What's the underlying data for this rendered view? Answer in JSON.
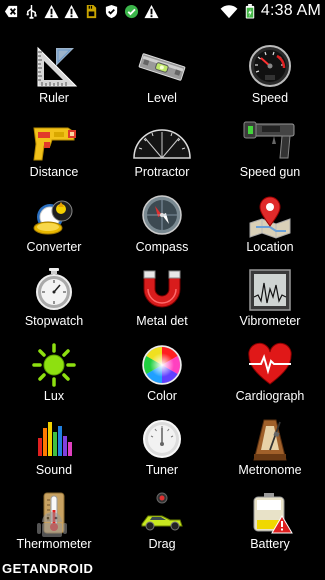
{
  "statusbar": {
    "time": "4:38 AM",
    "icons": [
      "notification-icon",
      "usb-icon",
      "warning-icon",
      "warning-icon",
      "sd-card-icon",
      "shield-icon",
      "check-circle-icon",
      "warning-icon",
      "wifi-icon",
      "battery-charging-icon"
    ]
  },
  "tools": [
    {
      "label": "Ruler",
      "icon": "ruler-icon"
    },
    {
      "label": "Level",
      "icon": "level-icon"
    },
    {
      "label": "Speed",
      "icon": "speedometer-icon"
    },
    {
      "label": "Distance",
      "icon": "laser-gun-icon"
    },
    {
      "label": "Protractor",
      "icon": "protractor-icon"
    },
    {
      "label": "Speed gun",
      "icon": "speed-gun-icon"
    },
    {
      "label": "Converter",
      "icon": "converter-icon"
    },
    {
      "label": "Compass",
      "icon": "compass-icon"
    },
    {
      "label": "Location",
      "icon": "map-pin-icon"
    },
    {
      "label": "Stopwatch",
      "icon": "stopwatch-icon"
    },
    {
      "label": "Metal det",
      "icon": "magnet-icon"
    },
    {
      "label": "Vibrometer",
      "icon": "vibrometer-icon"
    },
    {
      "label": "Lux",
      "icon": "sun-icon"
    },
    {
      "label": "Color",
      "icon": "color-wheel-icon"
    },
    {
      "label": "Cardiograph",
      "icon": "heart-pulse-icon"
    },
    {
      "label": "Sound",
      "icon": "equalizer-icon"
    },
    {
      "label": "Tuner",
      "icon": "tuner-icon"
    },
    {
      "label": "Metronome",
      "icon": "metronome-icon"
    },
    {
      "label": "Thermometer",
      "icon": "thermometer-icon"
    },
    {
      "label": "Drag",
      "icon": "car-icon"
    },
    {
      "label": "Battery",
      "icon": "battery-warning-icon"
    }
  ],
  "watermark": "GETANDROID"
}
